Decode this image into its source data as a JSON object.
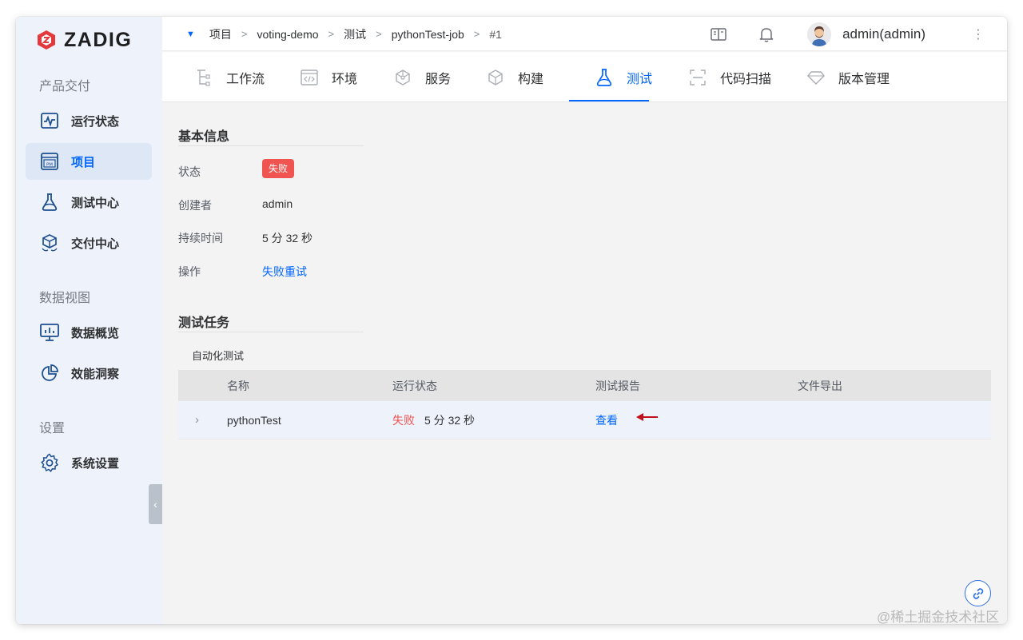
{
  "app": {
    "logo_text": "ZADIG"
  },
  "sidebar": {
    "sections": [
      {
        "label": "产品交付"
      },
      {
        "label": "数据视图"
      },
      {
        "label": "设置"
      }
    ],
    "items": [
      {
        "label": "运行状态",
        "icon": "pulse-icon",
        "active": false
      },
      {
        "label": "项目",
        "icon": "project-pm-icon",
        "active": true
      },
      {
        "label": "测试中心",
        "icon": "flask-icon",
        "active": false
      },
      {
        "label": "交付中心",
        "icon": "package-icon",
        "active": false
      },
      {
        "label": "数据概览",
        "icon": "monitor-chart-icon",
        "active": false
      },
      {
        "label": "效能洞察",
        "icon": "pie-chart-icon",
        "active": false
      },
      {
        "label": "系统设置",
        "icon": "gear-icon",
        "active": false
      }
    ],
    "collapse_icon": "chevron-left-icon"
  },
  "topbar": {
    "breadcrumb": [
      "项目",
      "voting-demo",
      "测试",
      "pythonTest-job",
      "#1"
    ],
    "separator": ">",
    "icons": [
      "docs-book-icon",
      "bell-icon"
    ],
    "user_name": "admin(admin)",
    "more_icon": "⋮"
  },
  "nav": {
    "tabs": [
      {
        "label": "工作流",
        "icon": "workflow-icon"
      },
      {
        "label": "环境",
        "icon": "code-window-icon"
      },
      {
        "label": "服务",
        "icon": "service-cube-icon"
      },
      {
        "label": "构建",
        "icon": "build-box-icon"
      },
      {
        "label": "测试",
        "icon": "flask-icon",
        "active": true
      },
      {
        "label": "代码扫描",
        "icon": "scan-icon"
      },
      {
        "label": "版本管理",
        "icon": "diamond-icon"
      }
    ]
  },
  "basic_info": {
    "title": "基本信息",
    "status_label": "状态",
    "status_value": "失败",
    "creator_label": "创建者",
    "creator_value": "admin",
    "duration_label": "持续时间",
    "duration_value": "5 分 32 秒",
    "action_label": "操作",
    "action_value": "失败重试"
  },
  "tasks": {
    "title": "测试任务",
    "subhead": "自动化测试",
    "columns": [
      "名称",
      "运行状态",
      "测试报告",
      "文件导出"
    ],
    "rows": [
      {
        "name": "pythonTest",
        "status": "失败",
        "duration": "5 分 32 秒",
        "report": "查看",
        "export": ""
      }
    ]
  },
  "watermark": "@稀土掘金技术社区",
  "colors": {
    "accent": "#0066ff",
    "danger": "#ef5451",
    "sidebar_bg": "#eef3fb",
    "arrow": "#c0101c"
  }
}
